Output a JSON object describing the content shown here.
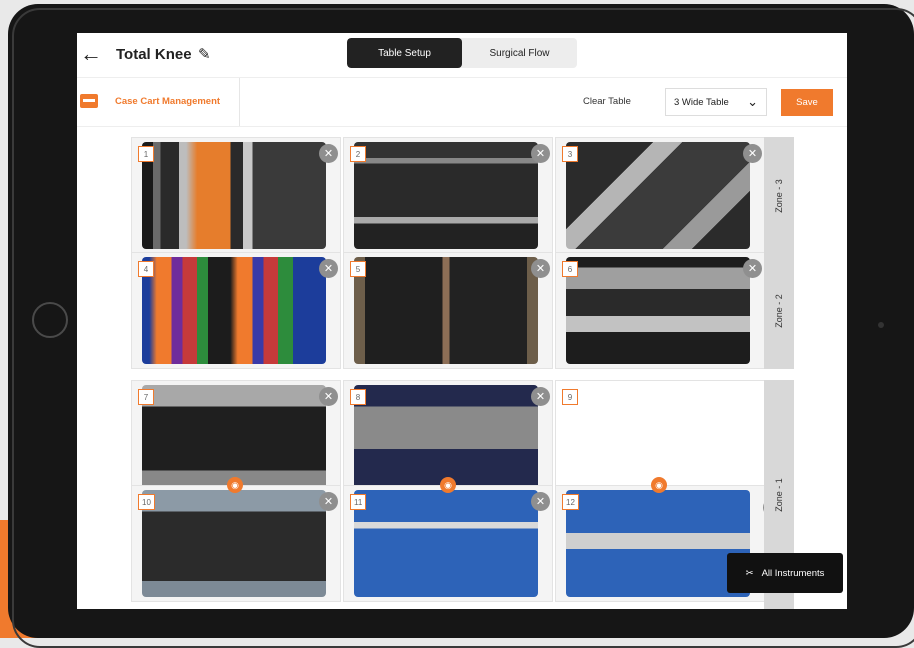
{
  "header": {
    "title": "Total Knee",
    "tabs": [
      {
        "label": "Table Setup",
        "active": true
      },
      {
        "label": "Surgical Flow",
        "active": false
      }
    ]
  },
  "toolbar": {
    "cart_label": "Case Cart Management",
    "clear_label": "Clear Table",
    "layout_select": "3 Wide Table",
    "save_label": "Save"
  },
  "zones": [
    "Zone - 3",
    "Zone - 2",
    "Zone - 1"
  ],
  "tiles": [
    {
      "number": "1",
      "zone": "Zone - 3"
    },
    {
      "number": "2",
      "zone": "Zone - 3"
    },
    {
      "number": "3",
      "zone": "Zone - 3"
    },
    {
      "number": "4",
      "zone": "Zone - 2"
    },
    {
      "number": "5",
      "zone": "Zone - 2"
    },
    {
      "number": "6",
      "zone": "Zone - 2"
    },
    {
      "number": "7",
      "zone": "Zone - 1"
    },
    {
      "number": "8",
      "zone": "Zone - 1"
    },
    {
      "number": "9",
      "zone": "Zone - 1",
      "empty": true
    },
    {
      "number": "10",
      "zone": "Zone - 1"
    },
    {
      "number": "11",
      "zone": "Zone - 1"
    },
    {
      "number": "12",
      "zone": "Zone - 1"
    }
  ],
  "all_instruments_label": "All Instruments",
  "colors": {
    "accent": "#f07a2d",
    "dark": "#222222"
  }
}
